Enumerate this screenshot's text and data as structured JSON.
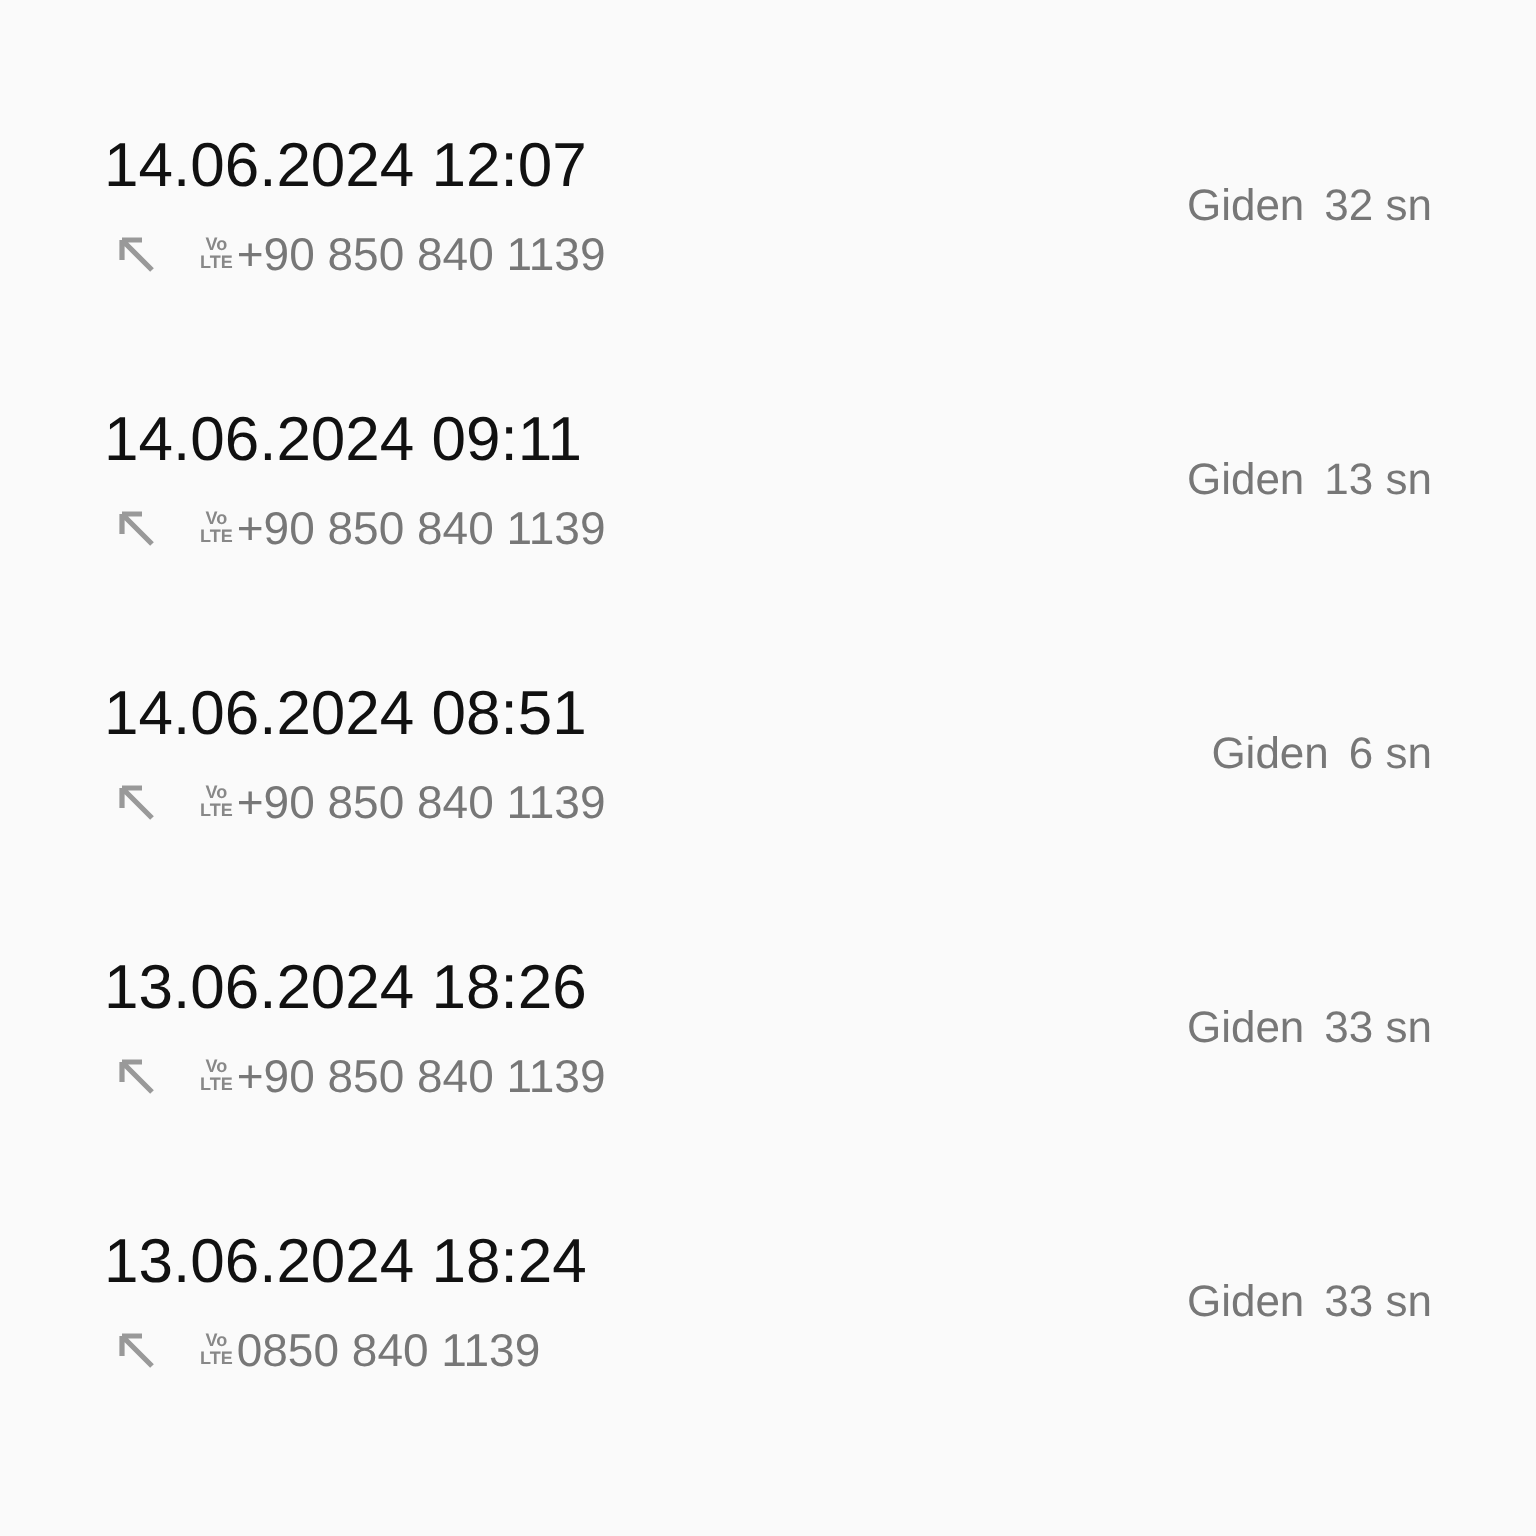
{
  "calls": [
    {
      "datetime": "14.06.2024 12:07",
      "badge_top": "Vo",
      "badge_bottom": "LTE",
      "number": "+90 850 840 1139",
      "direction": "Giden",
      "duration": "32 sn"
    },
    {
      "datetime": "14.06.2024 09:11",
      "badge_top": "Vo",
      "badge_bottom": "LTE",
      "number": "+90 850 840 1139",
      "direction": "Giden",
      "duration": "13 sn"
    },
    {
      "datetime": "14.06.2024 08:51",
      "badge_top": "Vo",
      "badge_bottom": "LTE",
      "number": "+90 850 840 1139",
      "direction": "Giden",
      "duration": "6 sn"
    },
    {
      "datetime": "13.06.2024 18:26",
      "badge_top": "Vo",
      "badge_bottom": "LTE",
      "number": "+90 850 840 1139",
      "direction": "Giden",
      "duration": "33 sn"
    },
    {
      "datetime": "13.06.2024 18:24",
      "badge_top": "Vo",
      "badge_bottom": "LTE",
      "number": "0850 840 1139",
      "direction": "Giden",
      "duration": "33 sn"
    }
  ]
}
